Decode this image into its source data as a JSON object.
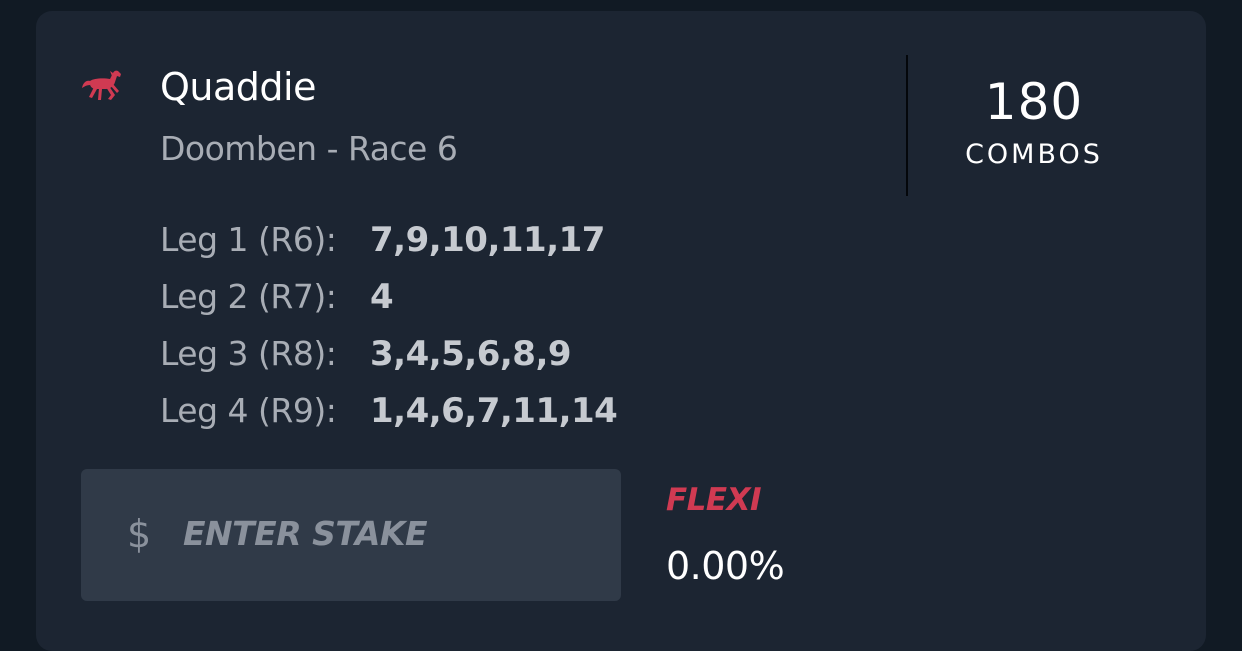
{
  "bet": {
    "icon": "horse-icon",
    "title": "Quaddie",
    "subtitle": "Doomben - Race 6"
  },
  "combos": {
    "value": "180",
    "label": "COMBOS"
  },
  "legs": [
    {
      "label": "Leg 1 (R6):",
      "selections": "7,9,10,11,17"
    },
    {
      "label": "Leg 2 (R7):",
      "selections": "4"
    },
    {
      "label": "Leg 3 (R8):",
      "selections": "3,4,5,6,8,9"
    },
    {
      "label": "Leg 4 (R9):",
      "selections": "1,4,6,7,11,14"
    }
  ],
  "stake": {
    "currency_symbol": "$",
    "placeholder": "ENTER STAKE",
    "value": ""
  },
  "flexi": {
    "label": "FLEXI",
    "value": "0.00%"
  },
  "colors": {
    "background": "#111a24",
    "card": "#1c2532",
    "accent": "#d03a52",
    "input_bg": "#303a48"
  }
}
